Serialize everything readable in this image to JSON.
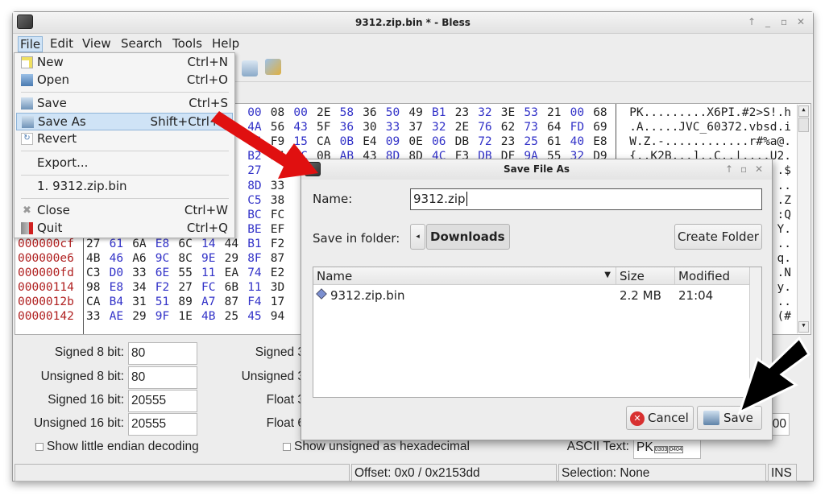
{
  "window": {
    "title": "9312.zip.bin * - Bless",
    "controls": [
      "↑",
      "_",
      "▫",
      "✕"
    ]
  },
  "menubar": [
    "File",
    "Edit",
    "View",
    "Search",
    "Tools",
    "Help"
  ],
  "hex": {
    "rows": [
      {
        "offset": "",
        "bytes": [
          "",
          "",
          "",
          "",
          "",
          "",
          "",
          "00",
          "08",
          "00",
          "2E",
          "58",
          "36",
          "50",
          "49",
          "B1",
          "23",
          "32",
          "3E",
          "53",
          "21",
          "00",
          "68"
        ],
        "ascii": "PK.........X6PI.#2>S!.h"
      },
      {
        "offset": "",
        "bytes": [
          "",
          "",
          "",
          "",
          "",
          "",
          "",
          "4A",
          "56",
          "43",
          "5F",
          "36",
          "30",
          "33",
          "37",
          "32",
          "2E",
          "76",
          "62",
          "73",
          "64",
          "FD",
          "69"
        ],
        "ascii": ".A.....JVC_60372.vbsd.i"
      },
      {
        "offset": "",
        "bytes": [
          "",
          "",
          "",
          "",
          "",
          "",
          "",
          "F6",
          "F9",
          "15",
          "CA",
          "0B",
          "E4",
          "09",
          "0E",
          "06",
          "DB",
          "72",
          "23",
          "25",
          "61",
          "40",
          "E8"
        ],
        "ascii": "W.Z.-............r#%a@."
      },
      {
        "offset": "",
        "bytes": [
          "",
          "",
          "",
          "",
          "",
          "",
          "",
          "B2",
          "24",
          "6C",
          "0B",
          "AB",
          "43",
          "8D",
          "8D",
          "4C",
          "F3",
          "DB",
          "DF",
          "9A",
          "55",
          "32",
          "D9"
        ],
        "ascii": "{..K2B...]..C..|....U2."
      },
      {
        "offset": "",
        "bytes": [
          "",
          "",
          "",
          "",
          "",
          "",
          "",
          "27"
        ],
        "ascii": ".$"
      },
      {
        "offset": "",
        "bytes": [
          "",
          "",
          "",
          "",
          "",
          "",
          "",
          "8D",
          "33"
        ],
        "ascii": ".."
      },
      {
        "offset": "",
        "bytes": [
          "",
          "",
          "",
          "",
          "",
          "",
          "",
          "C5",
          "38"
        ],
        "ascii": ".Z"
      },
      {
        "offset": "",
        "bytes": [
          "",
          "",
          "",
          "",
          "",
          "",
          "",
          "BC",
          "FC"
        ],
        "ascii": ":Q"
      },
      {
        "offset": "",
        "bytes": [
          "",
          "",
          "",
          "",
          "",
          "",
          "",
          "BE",
          "EF"
        ],
        "ascii": "Y."
      },
      {
        "offset": "000000cf",
        "bytes": [
          "27",
          "61",
          "6A",
          "E8",
          "6C",
          "14",
          "44",
          "B1",
          "F2"
        ],
        "ascii": ".."
      },
      {
        "offset": "000000e6",
        "bytes": [
          "4B",
          "46",
          "A6",
          "9C",
          "8C",
          "9E",
          "29",
          "8F",
          "87"
        ],
        "ascii": "q."
      },
      {
        "offset": "000000fd",
        "bytes": [
          "C3",
          "D0",
          "33",
          "6E",
          "55",
          "11",
          "EA",
          "74",
          "E2"
        ],
        "ascii": ".N"
      },
      {
        "offset": "00000114",
        "bytes": [
          "98",
          "E8",
          "34",
          "F2",
          "27",
          "FC",
          "6B",
          "11",
          "3D"
        ],
        "ascii": "y."
      },
      {
        "offset": "0000012b",
        "bytes": [
          "CA",
          "B4",
          "31",
          "51",
          "89",
          "A7",
          "87",
          "F4",
          "17"
        ],
        "ascii": ".."
      },
      {
        "offset": "00000142",
        "bytes": [
          "33",
          "AE",
          "29",
          "9F",
          "1E",
          "4B",
          "25",
          "45",
          "94"
        ],
        "ascii": "(#"
      }
    ]
  },
  "panel": {
    "left": [
      {
        "label": "Signed 8 bit:",
        "value": "80"
      },
      {
        "label": "Unsigned 8 bit:",
        "value": "80"
      },
      {
        "label": "Signed 16 bit:",
        "value": "20555"
      },
      {
        "label": "Unsigned 16 bit:",
        "value": "20555"
      }
    ],
    "mid": [
      "Signed 3",
      "Unsigned 3",
      "Float 3",
      "Float 6"
    ],
    "right_partial": "00",
    "cb1": "Show little endian decoding",
    "cb2": "Show unsigned as hexadecimal",
    "ascii_label": "ASCII Text:",
    "ascii_value": "PK"
  },
  "status": {
    "offset": "Offset: 0x0 / 0x2153dd",
    "selection": "Selection: None",
    "mode": "INS"
  },
  "file_menu": [
    {
      "label": "New",
      "shortcut": "Ctrl+N",
      "icon": "new-file-icon"
    },
    {
      "label": "Open",
      "shortcut": "Ctrl+O",
      "icon": "open-icon"
    },
    {
      "label": "Save",
      "shortcut": "Ctrl+S",
      "icon": "save-icon"
    },
    {
      "label": "Save As",
      "shortcut": "Shift+Ctrl+S",
      "icon": "save-as-icon"
    },
    {
      "label": "Revert",
      "shortcut": "",
      "icon": "revert-icon"
    },
    {
      "label": "Export...",
      "shortcut": ""
    },
    {
      "label": "1. 9312.zip.bin",
      "shortcut": ""
    },
    {
      "label": "Close",
      "shortcut": "Ctrl+W",
      "icon": "close-icon"
    },
    {
      "label": "Quit",
      "shortcut": "Ctrl+Q",
      "icon": "quit-icon"
    }
  ],
  "dialog": {
    "title": "Save File As",
    "name_label": "Name:",
    "name_value": "9312.zip",
    "folder_label": "Save in folder:",
    "folder": "Downloads",
    "create_folder": "Create Folder",
    "columns": [
      "Name",
      "Size",
      "Modified"
    ],
    "files": [
      {
        "name": "9312.zip.bin",
        "size": "2.2 MB",
        "modified": "21:04"
      }
    ],
    "cancel": "Cancel",
    "save": "Save"
  },
  "colors": {
    "accent": "#cfe3f6",
    "hex_offset": "#b02020",
    "hex_odd": "#3232c8",
    "arrow_red": "#e01010",
    "arrow_black": "#000000"
  }
}
